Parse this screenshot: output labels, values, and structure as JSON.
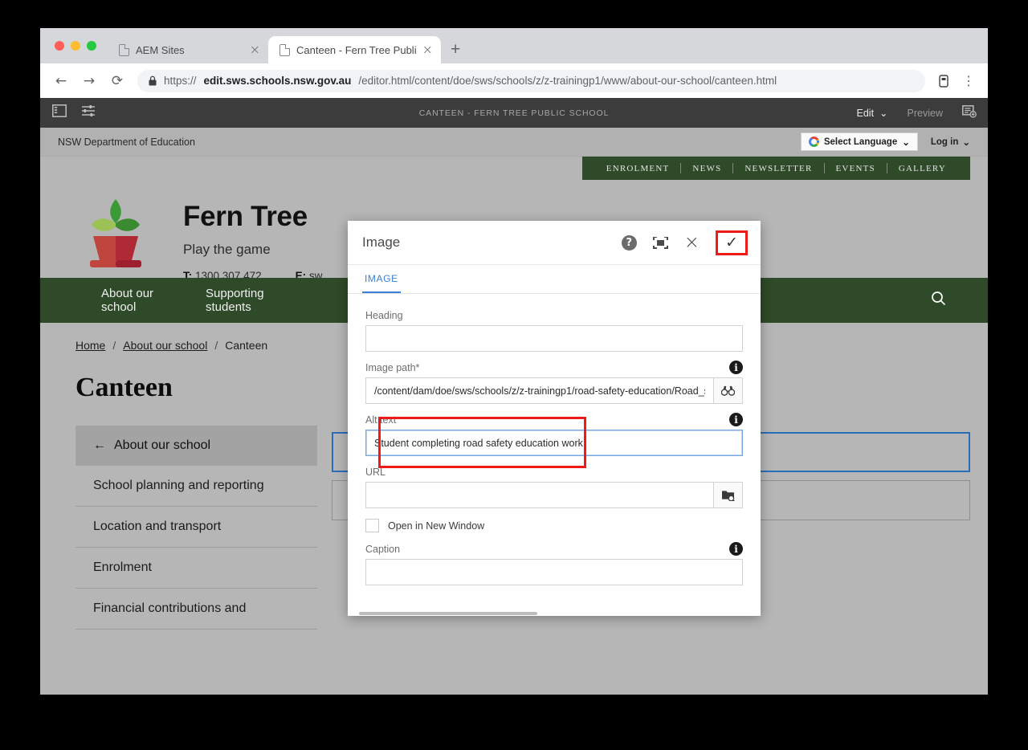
{
  "browser": {
    "tabs": [
      {
        "title": "AEM Sites",
        "active": false,
        "close_label": "×"
      },
      {
        "title": "Canteen - Fern Tree Public Sch",
        "active": true,
        "close_label": "×"
      }
    ],
    "new_tab_label": "+",
    "back_label": "←",
    "forward_label": "→",
    "reload_label": "⟳",
    "lock_label": "🔒",
    "url": {
      "scheme": "https://",
      "host": "edit.sws.schools.nsw.gov.au",
      "path": "/editor.html/content/doe/sws/schools/z/z-trainingp1/www/about-our-school/canteen.html"
    },
    "profile_icon": "profile-icon",
    "menu_label": "⋮"
  },
  "aem_toolbar": {
    "sidepanel_icon": "sidepanel-toggle-icon",
    "settings_icon": "page-properties-icon",
    "title": "CANTEEN - FERN TREE PUBLIC SCHOOL",
    "edit_label": "Edit",
    "edit_chevron": "⌄",
    "preview_label": "Preview",
    "annotate_icon": "add-annotation-icon"
  },
  "site": {
    "utility": {
      "department": "NSW Department of Education",
      "language_label": "Select Language",
      "language_chevron": "⌄",
      "login_label": "Log in",
      "login_chevron": "⌄"
    },
    "topnav": [
      "ENROLMENT",
      "NEWS",
      "NEWSLETTER",
      "EVENTS",
      "GALLERY"
    ],
    "identity": {
      "school_name": "Fern Tree",
      "tagline": "Play the game",
      "phone_label": "T:",
      "phone": "1300 307 472",
      "email_label": "E:",
      "email": "sw"
    },
    "mainnav": [
      "About our school",
      "Supporting students"
    ],
    "search_icon": "search-icon",
    "breadcrumb": [
      {
        "label": "Home",
        "link": true
      },
      {
        "label": "About our school",
        "link": true
      },
      {
        "label": "Canteen",
        "link": false
      }
    ],
    "breadcrumb_separator": "/",
    "page_title": "Canteen",
    "leftnav": {
      "back_arrow": "←",
      "current": "About our school",
      "items": [
        "School planning and reporting",
        "Location and transport",
        "Enrolment",
        "Financial contributions and"
      ]
    }
  },
  "dialog": {
    "title": "Image",
    "help_label": "?",
    "help_icon": "help-icon",
    "fullscreen_icon": "fullscreen-icon",
    "close_label": "×",
    "close_icon": "close-icon",
    "confirm_label": "✓",
    "confirm_icon": "check-icon",
    "tab_label": "IMAGE",
    "fields": {
      "heading": {
        "label": "Heading",
        "value": ""
      },
      "image_path": {
        "label": "Image path*",
        "value": "/content/dam/doe/sws/schools/z/z-trainingp1/road-safety-education/Road_s",
        "picker_icon": "binoculars-icon",
        "info_icon": "info-icon"
      },
      "alt_text": {
        "label": "Alt text",
        "value": "Student completing road safety education work",
        "info_icon": "info-icon",
        "focused": true
      },
      "url": {
        "label": "URL",
        "value": "",
        "picker_icon": "page-search-icon"
      },
      "open_new_window": {
        "label": "Open in New Window",
        "checked": false
      },
      "caption": {
        "label": "Caption",
        "value": "",
        "info_icon": "info-icon"
      }
    }
  },
  "colors": {
    "brand_green": "#2f4a28",
    "page_bg": "#b6b6b6",
    "highlight_red": "#ee1b1b",
    "accent_blue": "#3a7fd5",
    "selected_blue": "#2a6ebb"
  }
}
